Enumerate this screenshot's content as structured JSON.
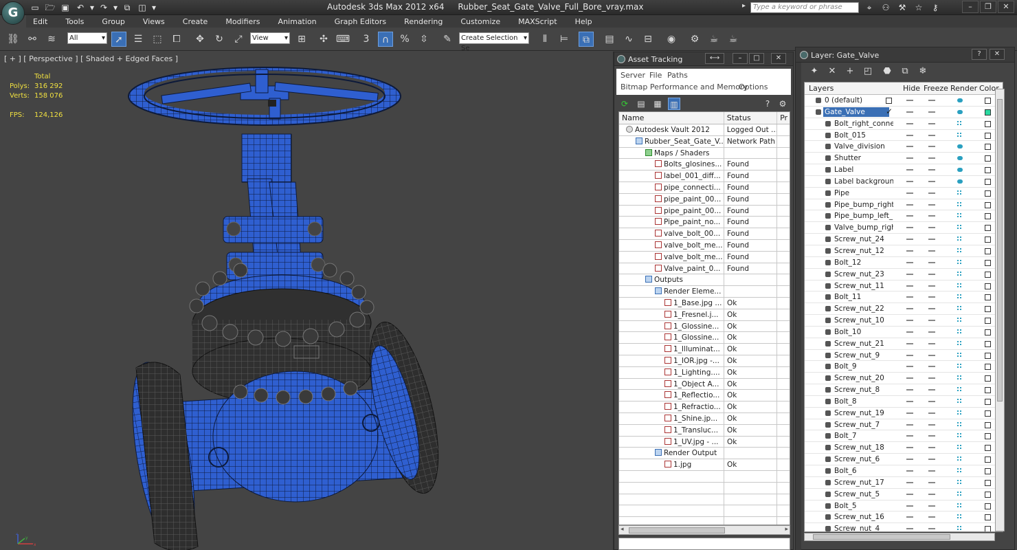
{
  "app": {
    "title": "Autodesk 3ds Max  2012 x64",
    "file": "Rubber_Seat_Gate_Valve_Full_Bore_vray.max",
    "search_placeholder": "Type a keyword or phrase",
    "logo": "3ds-max-logo"
  },
  "menu": [
    "Edit",
    "Tools",
    "Group",
    "Views",
    "Create",
    "Modifiers",
    "Animation",
    "Graph Editors",
    "Rendering",
    "Customize",
    "MAXScript",
    "Help"
  ],
  "toolbar": {
    "selection_filter": "All",
    "reference_coord": "View",
    "named_selection": "Create Selection Se"
  },
  "viewport": {
    "label": "[ + ] [ Perspective ] [ Shaded + Edged Faces ]",
    "stats": {
      "total_label": "Total",
      "polys_label": "Polys:",
      "polys": "316 292",
      "verts_label": "Verts:",
      "verts": "158 076",
      "fps_label": "FPS:",
      "fps": "124,126"
    },
    "axis": {
      "x": "x",
      "y": "y",
      "z": "z"
    }
  },
  "asset_tracking": {
    "title": "Asset Tracking",
    "menu": {
      "server": "Server",
      "file": "File",
      "paths": "Paths",
      "bitmap": "Bitmap Performance and Memory",
      "options": "Options"
    },
    "columns": {
      "name": "Name",
      "status": "Status",
      "pr": "Pr"
    },
    "rows": [
      {
        "name": "Autodesk Vault 2012",
        "status": "Logged Out ...",
        "indent": 1,
        "icon": "gray"
      },
      {
        "name": "Rubber_Seat_Gate_V...",
        "status": "Network Path",
        "indent": 2,
        "icon": "blue"
      },
      {
        "name": "Maps / Shaders",
        "status": "",
        "indent": 3,
        "icon": "green"
      },
      {
        "name": "Bolts_glosines...",
        "status": "Found",
        "indent": 4,
        "icon": "red"
      },
      {
        "name": "label_001_diff...",
        "status": "Found",
        "indent": 4,
        "icon": "red"
      },
      {
        "name": "pipe_connecti...",
        "status": "Found",
        "indent": 4,
        "icon": "red"
      },
      {
        "name": "pipe_paint_00...",
        "status": "Found",
        "indent": 4,
        "icon": "red"
      },
      {
        "name": "pipe_paint_00...",
        "status": "Found",
        "indent": 4,
        "icon": "red"
      },
      {
        "name": "Pipe_paint_no...",
        "status": "Found",
        "indent": 4,
        "icon": "red"
      },
      {
        "name": "valve_bolt_00...",
        "status": "Found",
        "indent": 4,
        "icon": "red"
      },
      {
        "name": "valve_bolt_me...",
        "status": "Found",
        "indent": 4,
        "icon": "red"
      },
      {
        "name": "valve_bolt_me...",
        "status": "Found",
        "indent": 4,
        "icon": "red"
      },
      {
        "name": "Valve_paint_0...",
        "status": "Found",
        "indent": 4,
        "icon": "red"
      },
      {
        "name": "Outputs",
        "status": "",
        "indent": 3,
        "icon": "blue"
      },
      {
        "name": "Render Eleme...",
        "status": "",
        "indent": 4,
        "icon": "blue"
      },
      {
        "name": "1_Base.jpg ...",
        "status": "Ok",
        "indent": 5,
        "icon": "red"
      },
      {
        "name": "1_Fresnel.j...",
        "status": "Ok",
        "indent": 5,
        "icon": "red"
      },
      {
        "name": "1_Glossine...",
        "status": "Ok",
        "indent": 5,
        "icon": "red"
      },
      {
        "name": "1_Glossine...",
        "status": "Ok",
        "indent": 5,
        "icon": "red"
      },
      {
        "name": "1_Illuminat...",
        "status": "Ok",
        "indent": 5,
        "icon": "red"
      },
      {
        "name": "1_IOR.jpg -...",
        "status": "Ok",
        "indent": 5,
        "icon": "red"
      },
      {
        "name": "1_Lighting....",
        "status": "Ok",
        "indent": 5,
        "icon": "red"
      },
      {
        "name": "1_Object A...",
        "status": "Ok",
        "indent": 5,
        "icon": "red"
      },
      {
        "name": "1_Reflectio...",
        "status": "Ok",
        "indent": 5,
        "icon": "red"
      },
      {
        "name": "1_Refractio...",
        "status": "Ok",
        "indent": 5,
        "icon": "red"
      },
      {
        "name": "1_Shine.jp...",
        "status": "Ok",
        "indent": 5,
        "icon": "red"
      },
      {
        "name": "1_Transluc...",
        "status": "Ok",
        "indent": 5,
        "icon": "red"
      },
      {
        "name": "1_UV.jpg - ...",
        "status": "Ok",
        "indent": 5,
        "icon": "red"
      },
      {
        "name": "Render Output",
        "status": "",
        "indent": 4,
        "icon": "blue"
      },
      {
        "name": "1.jpg",
        "status": "Ok",
        "indent": 5,
        "icon": "red"
      },
      {
        "name": "",
        "status": "",
        "indent": 0,
        "icon": ""
      },
      {
        "name": "",
        "status": "",
        "indent": 0,
        "icon": ""
      },
      {
        "name": "",
        "status": "",
        "indent": 0,
        "icon": ""
      },
      {
        "name": "",
        "status": "",
        "indent": 0,
        "icon": ""
      },
      {
        "name": "",
        "status": "",
        "indent": 0,
        "icon": ""
      }
    ]
  },
  "layers": {
    "title": "Layer: Gate_Valve",
    "columns": {
      "layers": "Layers",
      "hide": "Hide",
      "freeze": "Freeze",
      "render": "Render",
      "color": "Color"
    },
    "rows": [
      {
        "name": "0 (default)",
        "level": 0,
        "render": "solid",
        "color": "white",
        "flag": "box"
      },
      {
        "name": "Gate_Valve",
        "level": 0,
        "render": "solid",
        "color": "green",
        "selected": true,
        "flag": "check"
      },
      {
        "name": "Bolt_right_conne",
        "level": 1,
        "render": "dot",
        "color": "white"
      },
      {
        "name": "Bolt_015",
        "level": 1,
        "render": "dot",
        "color": "white"
      },
      {
        "name": "Valve_division",
        "level": 1,
        "render": "solid",
        "color": "white"
      },
      {
        "name": "Shutter",
        "level": 1,
        "render": "solid",
        "color": "white"
      },
      {
        "name": "Label",
        "level": 1,
        "render": "solid",
        "color": "white"
      },
      {
        "name": "Label backgroun",
        "level": 1,
        "render": "solid",
        "color": "white"
      },
      {
        "name": "Pipe",
        "level": 1,
        "render": "dot",
        "color": "white"
      },
      {
        "name": "Pipe_bump_right",
        "level": 1,
        "render": "dot",
        "color": "white"
      },
      {
        "name": "Pipe_bump_left_",
        "level": 1,
        "render": "dot",
        "color": "white"
      },
      {
        "name": "Valve_bump_righ",
        "level": 1,
        "render": "dot",
        "color": "white"
      },
      {
        "name": "Screw_nut_24",
        "level": 1,
        "render": "dot",
        "color": "white"
      },
      {
        "name": "Screw_nut_12",
        "level": 1,
        "render": "dot",
        "color": "white"
      },
      {
        "name": "Bolt_12",
        "level": 1,
        "render": "dot",
        "color": "white"
      },
      {
        "name": "Screw_nut_23",
        "level": 1,
        "render": "dot",
        "color": "white"
      },
      {
        "name": "Screw_nut_11",
        "level": 1,
        "render": "dot",
        "color": "white"
      },
      {
        "name": "Bolt_11",
        "level": 1,
        "render": "dot",
        "color": "white"
      },
      {
        "name": "Screw_nut_22",
        "level": 1,
        "render": "dot",
        "color": "white"
      },
      {
        "name": "Screw_nut_10",
        "level": 1,
        "render": "dot",
        "color": "white"
      },
      {
        "name": "Bolt_10",
        "level": 1,
        "render": "dot",
        "color": "white"
      },
      {
        "name": "Screw_nut_21",
        "level": 1,
        "render": "dot",
        "color": "white"
      },
      {
        "name": "Screw_nut_9",
        "level": 1,
        "render": "dot",
        "color": "white"
      },
      {
        "name": "Bolt_9",
        "level": 1,
        "render": "dot",
        "color": "white"
      },
      {
        "name": "Screw_nut_20",
        "level": 1,
        "render": "dot",
        "color": "white"
      },
      {
        "name": "Screw_nut_8",
        "level": 1,
        "render": "dot",
        "color": "white"
      },
      {
        "name": "Bolt_8",
        "level": 1,
        "render": "dot",
        "color": "white"
      },
      {
        "name": "Screw_nut_19",
        "level": 1,
        "render": "dot",
        "color": "white"
      },
      {
        "name": "Screw_nut_7",
        "level": 1,
        "render": "dot",
        "color": "white"
      },
      {
        "name": "Bolt_7",
        "level": 1,
        "render": "dot",
        "color": "white"
      },
      {
        "name": "Screw_nut_18",
        "level": 1,
        "render": "dot",
        "color": "white"
      },
      {
        "name": "Screw_nut_6",
        "level": 1,
        "render": "dot",
        "color": "white"
      },
      {
        "name": "Bolt_6",
        "level": 1,
        "render": "dot",
        "color": "white"
      },
      {
        "name": "Screw_nut_17",
        "level": 1,
        "render": "dot",
        "color": "white"
      },
      {
        "name": "Screw_nut_5",
        "level": 1,
        "render": "dot",
        "color": "white"
      },
      {
        "name": "Bolt_5",
        "level": 1,
        "render": "dot",
        "color": "white"
      },
      {
        "name": "Screw_nut_16",
        "level": 1,
        "render": "dot",
        "color": "white"
      },
      {
        "name": "Screw_nut_4",
        "level": 1,
        "render": "dot",
        "color": "white"
      }
    ]
  },
  "colors": {
    "accent": "#3a6fb5",
    "model_blue": "#2f5fd0",
    "wire": "#0d1a3a",
    "stats": "#f0e040",
    "render_icon": "#2aa0c0",
    "layer_green": "#2ad9a0"
  }
}
